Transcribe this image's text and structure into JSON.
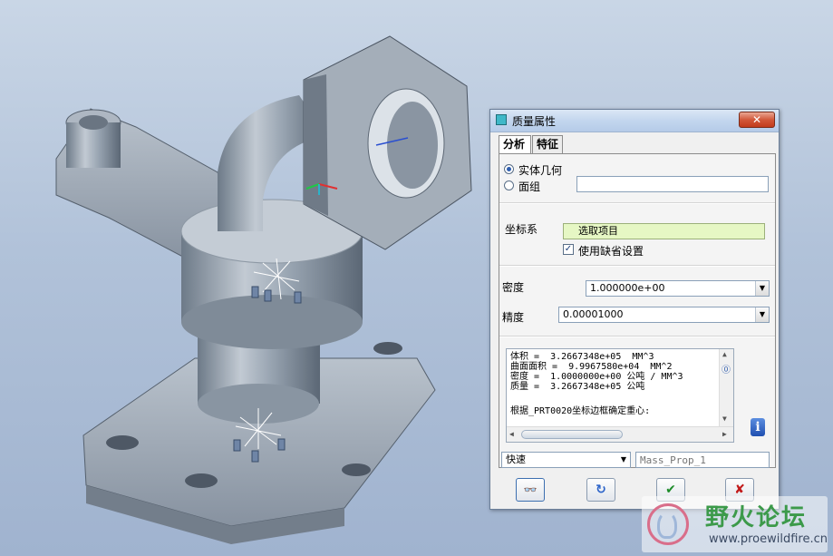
{
  "dialog": {
    "title": "质量属性",
    "close_label": "✕",
    "tabs": [
      {
        "label": "分析"
      },
      {
        "label": "特征"
      }
    ],
    "geometry": {
      "solid_label": "实体几何",
      "quilt_label": "面组",
      "quilt_value": ""
    },
    "csys": {
      "label": "坐标系",
      "select_button": "选取项目",
      "use_default_label": "使用缺省设置",
      "use_default_checked": true
    },
    "density": {
      "label": "密度",
      "value": "1.000000e+00"
    },
    "accuracy": {
      "label": "精度",
      "value": "0.00001000"
    },
    "results": {
      "lines": [
        "体积 =  3.2667348e+05  MM^3",
        "曲面面积 =  9.9967580e+04  MM^2",
        "密度 =  1.0000000e+00 公吨 / MM^3",
        "质量 =  3.2667348e+05 公吨",
        "",
        "根据_PRT0020坐标边框确定重心:"
      ]
    },
    "mode": {
      "value": "快速"
    },
    "name_field": {
      "placeholder": "Mass_Prop_1"
    },
    "buttons": {
      "preview": "👓",
      "repeat": "↻",
      "ok": "✔",
      "cancel": "✘"
    }
  },
  "watermark": {
    "title": "野火论坛",
    "url": "www.proewildfire.cn"
  },
  "colors": {
    "accent_green_ok": "#1e8c2a",
    "cancel_red": "#c21a1a",
    "select_highlight": "#e6f7c4"
  }
}
